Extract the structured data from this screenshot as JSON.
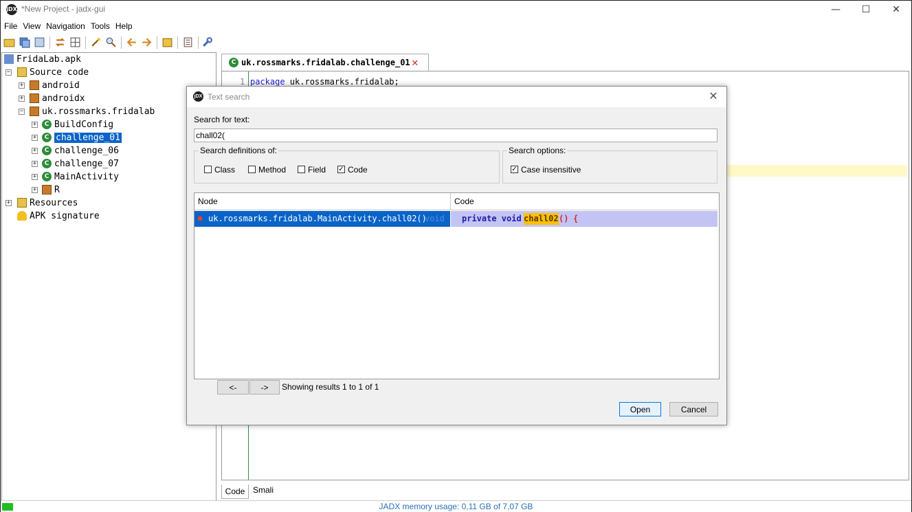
{
  "window": {
    "title": "*New Project - jadx-gui",
    "app_icon_text": "jDX",
    "minimize": "—",
    "maximize": "☐",
    "close": "✕"
  },
  "menu": [
    "File",
    "View",
    "Navigation",
    "Tools",
    "Help"
  ],
  "tree": {
    "root": "FridaLab.apk",
    "source_code": "Source code",
    "packages": [
      "android",
      "androidx",
      "uk.rossmarks.fridalab"
    ],
    "classes": [
      "BuildConfig",
      "challenge_01",
      "challenge_06",
      "challenge_07",
      "MainActivity",
      "R"
    ],
    "resources": "Resources",
    "apk_signature": "APK signature"
  },
  "editor": {
    "tab_label": "uk.rossmarks.fridalab.challenge_01",
    "line_number": "1",
    "code_keyword": "package",
    "code_rest": " uk.rossmarks.fridalab;"
  },
  "bottom_tabs": [
    "Code",
    "Smali"
  ],
  "status": {
    "memory": "JADX memory usage: 0,11 GB of 7,07 GB"
  },
  "dialog": {
    "title": "Text search",
    "search_label": "Search for text:",
    "search_value": "chall02(",
    "definitions_label": "Search definitions of:",
    "definitions": [
      {
        "label": "Class",
        "checked": false
      },
      {
        "label": "Method",
        "checked": false
      },
      {
        "label": "Field",
        "checked": false
      },
      {
        "label": "Code",
        "checked": true
      }
    ],
    "options_label": "Search options:",
    "options": [
      {
        "label": "Case insensitive",
        "checked": true
      }
    ],
    "columns": [
      "Node",
      "Code"
    ],
    "result": {
      "node": "uk.rossmarks.fridalab.MainActivity.chall02()",
      "node_type": "void",
      "code_kw": "private void",
      "code_match": "chall02",
      "code_paren": "()",
      "code_brace": "{"
    },
    "prev": "<-",
    "next": "->",
    "showing": "Showing results 1 to 1 of 1",
    "open": "Open",
    "cancel": "Cancel"
  },
  "colors": {
    "accent": "#0a64c8",
    "match": "#ffc000",
    "status_text": "#2a6fb6"
  }
}
